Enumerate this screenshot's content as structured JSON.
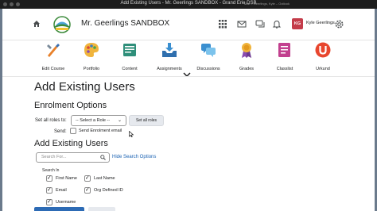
{
  "window": {
    "title": "Add Existing Users - Mr. Geerlings SANDBOX - Grand Erie DSB",
    "right_text": "Mail – Geerlings, Kyle – Outlook"
  },
  "header": {
    "course_title": "Mr. Geerlings SANDBOX",
    "user_initials": "KG",
    "user_name": "Kyle Geerlings"
  },
  "toolbar": [
    {
      "label": "Edit Course",
      "icon": "paintbrush-wrench-icon"
    },
    {
      "label": "Portfolio",
      "icon": "palette-icon"
    },
    {
      "label": "Content",
      "icon": "content-book-icon"
    },
    {
      "label": "Assignments",
      "icon": "dropbox-tray-icon"
    },
    {
      "label": "Discussions",
      "icon": "speech-bubbles-icon"
    },
    {
      "label": "Grades",
      "icon": "award-ribbon-icon"
    },
    {
      "label": "Classlist",
      "icon": "classlist-icon"
    },
    {
      "label": "Urkund",
      "icon": "urkund-icon"
    }
  ],
  "page": {
    "title": "Add Existing Users"
  },
  "enrolment": {
    "heading": "Enrolment Options",
    "set_all_roles_label": "Set all roles to:",
    "role_select_value": "-- Select a Role --",
    "set_all_roles_button": "Set all roles",
    "send_label": "Send:",
    "send_email_label": "Send Enrolment email",
    "send_email_checked": false
  },
  "search": {
    "heading": "Add Existing Users",
    "placeholder": "Search For...",
    "hide_options_link": "Hide Search Options",
    "search_in_label": "Search In",
    "fields": [
      {
        "label": "First Name",
        "checked": true
      },
      {
        "label": "Last Name",
        "checked": true
      },
      {
        "label": "Email",
        "checked": true
      },
      {
        "label": "Org Defined ID",
        "checked": true
      },
      {
        "label": "Username",
        "checked": true
      }
    ]
  },
  "colors": {
    "brand_red": "#c43c4a",
    "link_blue": "#1a62b3",
    "primary_button": "#2d6bb5"
  }
}
